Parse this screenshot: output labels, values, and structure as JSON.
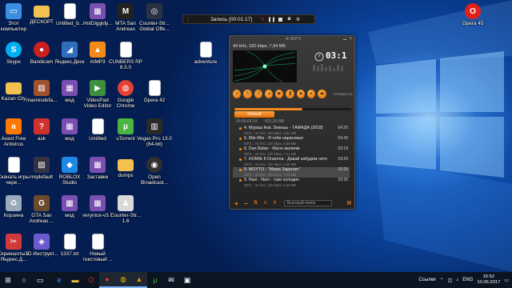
{
  "desktop_icons": [
    {
      "label": "Этот компьютер",
      "icon": "computer-icon",
      "color": "#3a8fe0"
    },
    {
      "label": "ДЕСКОРТ",
      "icon": "folder-icon",
      "color": "#f2c14e"
    },
    {
      "label": "Untitled_b...",
      "icon": "document-icon",
      "color": "#ffffff"
    },
    {
      "label": "HotDiggidy...",
      "icon": "archive-icon",
      "color": "#7a4fb0"
    },
    {
      "label": "MTA San Andreas",
      "icon": "mta-icon",
      "color": "#222222"
    },
    {
      "label": "Counter-Str... Global Offe...",
      "icon": "csgo-icon",
      "color": "#2a3140"
    },
    {
      "label": "Skype",
      "icon": "skype-icon",
      "color": "#00aff0"
    },
    {
      "label": "Bandicam",
      "icon": "bandicam-icon",
      "color": "#cc1f1f"
    },
    {
      "label": "Яндекс.Диск",
      "icon": "yandex-disk-icon",
      "color": "#2f6ebd"
    },
    {
      "label": "AIMP3",
      "icon": "aimp-icon",
      "color": "#f28a1a"
    },
    {
      "label": "CUNBERS RP 8.5.0",
      "icon": "document-icon",
      "color": "#ffffff"
    },
    {
      "label": "adventure",
      "icon": "document-icon",
      "color": "#ffffff"
    },
    {
      "label": "Kazan City",
      "icon": "folder-icon",
      "color": "#f2c14e"
    },
    {
      "label": "maxresdefa...",
      "icon": "image-icon",
      "color": "#a0522d"
    },
    {
      "label": "мод",
      "icon": "archive-icon",
      "color": "#7a4fb0"
    },
    {
      "label": "VideoPad Video Editor",
      "icon": "videopad-icon",
      "color": "#3e8f3e"
    },
    {
      "label": "Google Chrome",
      "icon": "chrome-icon",
      "color": "#e34133"
    },
    {
      "label": "Opera 42",
      "icon": "document-icon",
      "color": "#ffffff"
    },
    {
      "label": "Avast Free Antivirus",
      "icon": "avast-icon",
      "color": "#ff7800"
    },
    {
      "label": "ask",
      "icon": "ask-icon",
      "color": "#d0312d"
    },
    {
      "label": "мод",
      "icon": "archive-icon",
      "color": "#7a4fb0"
    },
    {
      "label": "Untitled",
      "icon": "document-icon",
      "color": "#ffffff"
    },
    {
      "label": "uTorrent",
      "icon": "utorrent-icon",
      "color": "#4bb543"
    },
    {
      "label": "Vegas Pro 13.0 (64-bit)",
      "icon": "vegas-icon",
      "color": "#2a2a2a"
    },
    {
      "label": "Скачать игры чере...",
      "icon": "document-icon",
      "color": "#ffffff"
    },
    {
      "label": "mqdefault",
      "icon": "image-icon",
      "color": "#334"
    },
    {
      "label": "ROBLOX Studio",
      "icon": "roblox-icon",
      "color": "#1e88e5"
    },
    {
      "label": "Заставки",
      "icon": "archive-icon",
      "color": "#7a4fb0"
    },
    {
      "label": "dumps",
      "icon": "folder-icon",
      "color": "#f2c14e"
    },
    {
      "label": "Open Broadcast...",
      "icon": "obs-icon",
      "color": "#302e31"
    },
    {
      "label": "Корзина",
      "icon": "recycle-bin-icon",
      "color": "#9ab"
    },
    {
      "label": "GTA San Andreas ...",
      "icon": "gta-icon",
      "color": "#6b4b2b"
    },
    {
      "label": "мод",
      "icon": "archive-icon",
      "color": "#7a4fb0"
    },
    {
      "label": "verynice-v3.7",
      "icon": "archive-icon",
      "color": "#7a4fb0"
    },
    {
      "label": "Counter-Str... 1.6",
      "icon": "cs16-icon",
      "color": "#d9d9d9"
    },
    {
      "label": "Скриншоты в Яндекс.Д...",
      "icon": "screenshot-icon",
      "color": "#d13a3a"
    },
    {
      "label": "3D Инструкт...",
      "icon": "3d-icon",
      "color": "#6a5acd"
    },
    {
      "label": "1337.txt",
      "icon": "document-icon",
      "color": "#ffffff"
    },
    {
      "label": "Новый текстовый ...",
      "icon": "document-icon",
      "color": "#ffffff"
    },
    {
      "label": "Opera 45",
      "icon": "opera-icon",
      "color": "#e0201b"
    }
  ],
  "recorder": {
    "label": "Запись [00:01:17]"
  },
  "player": {
    "logo": "AIMP3",
    "info": "44 kHz, 320 kbps, 7,94 МБ",
    "time": "03:1",
    "time_prefix": "⏱",
    "volume_label": "ГРОМКОСТЬ",
    "progress": 0.58,
    "playlist_tab": "Default",
    "playlist_header": [
      "00:00:05:24",
      "651,56 МБ"
    ],
    "tracks": [
      {
        "title": "4. Мураш feat. Знаешь - ТАМАДА (2018)",
        "sub": "MP3 :: 44 kHz, 320 kbps, 9,84 MB",
        "time": "04:20"
      },
      {
        "title": "5. 80e-06e - Я тебя нарисовал",
        "sub": "MP3 :: 44 kHz, 320 kbps, 8,58 MB",
        "time": "03:45"
      },
      {
        "title": "6. Dan Balan - Мало малиям",
        "sub": "MP3 :: 44 kHz, 320 kbps, 7,41 MB",
        "time": "03:18"
      },
      {
        "title": "7. HOMIE ft Dramma - Давай забудем лето",
        "sub": "MP3 :: 44 kHz, 320 kbps, 8,06 MB",
        "time": "03:29"
      },
      {
        "title": "8. MOYTO - \"Мама Заругает\"",
        "sub": "MP3 :: 44 kHz, 320 kbps, 7,94 MB",
        "time": "03:28",
        "selected": true
      },
      {
        "title": "9. Navi - Navi - таки холодин",
        "sub": "MP3 :: 44 kHz, 320 kbps, 8,29 MB",
        "time": "03:35"
      }
    ],
    "search_placeholder": "Быстрый поиск",
    "accent": "#f58a1f"
  },
  "taskbar": {
    "items": [
      "start-icon",
      "search-icon",
      "task-view-icon",
      "edge-icon",
      "explorer-icon",
      "opera-icon",
      "bandicam-icon",
      "chrome-icon",
      "aimp-icon",
      "utorrent-icon",
      "mail-icon",
      "store-icon"
    ],
    "tray_label": "Ссылки",
    "lang": "ENG",
    "time": "16:52",
    "date": "10.06.2017"
  }
}
